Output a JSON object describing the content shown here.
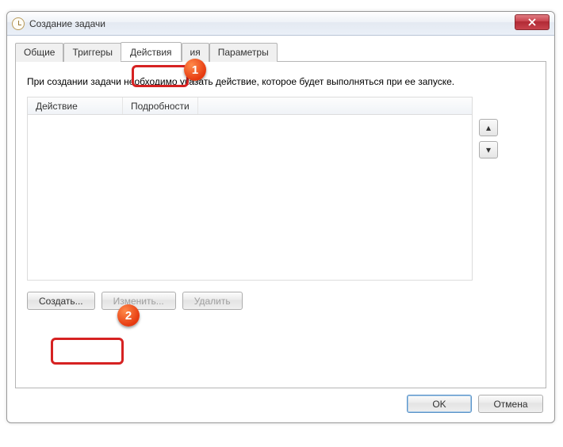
{
  "window": {
    "title": "Создание задачи"
  },
  "tabs": {
    "general": "Общие",
    "triggers": "Триггеры",
    "actions": "Действия",
    "conditions_suffix": "ия",
    "params": "Параметры"
  },
  "panel": {
    "instruction": "При создании задачи необходимо указать действие, которое будет выполняться при ее запуске.",
    "col_action": "Действие",
    "col_details": "Подробности"
  },
  "buttons": {
    "create": "Создать...",
    "edit": "Изменить...",
    "delete": "Удалить",
    "ok": "OK",
    "cancel": "Отмена"
  },
  "icons": {
    "arrow_up": "▴",
    "arrow_down": "▾"
  },
  "annotations": {
    "a1": "1",
    "a2": "2"
  }
}
